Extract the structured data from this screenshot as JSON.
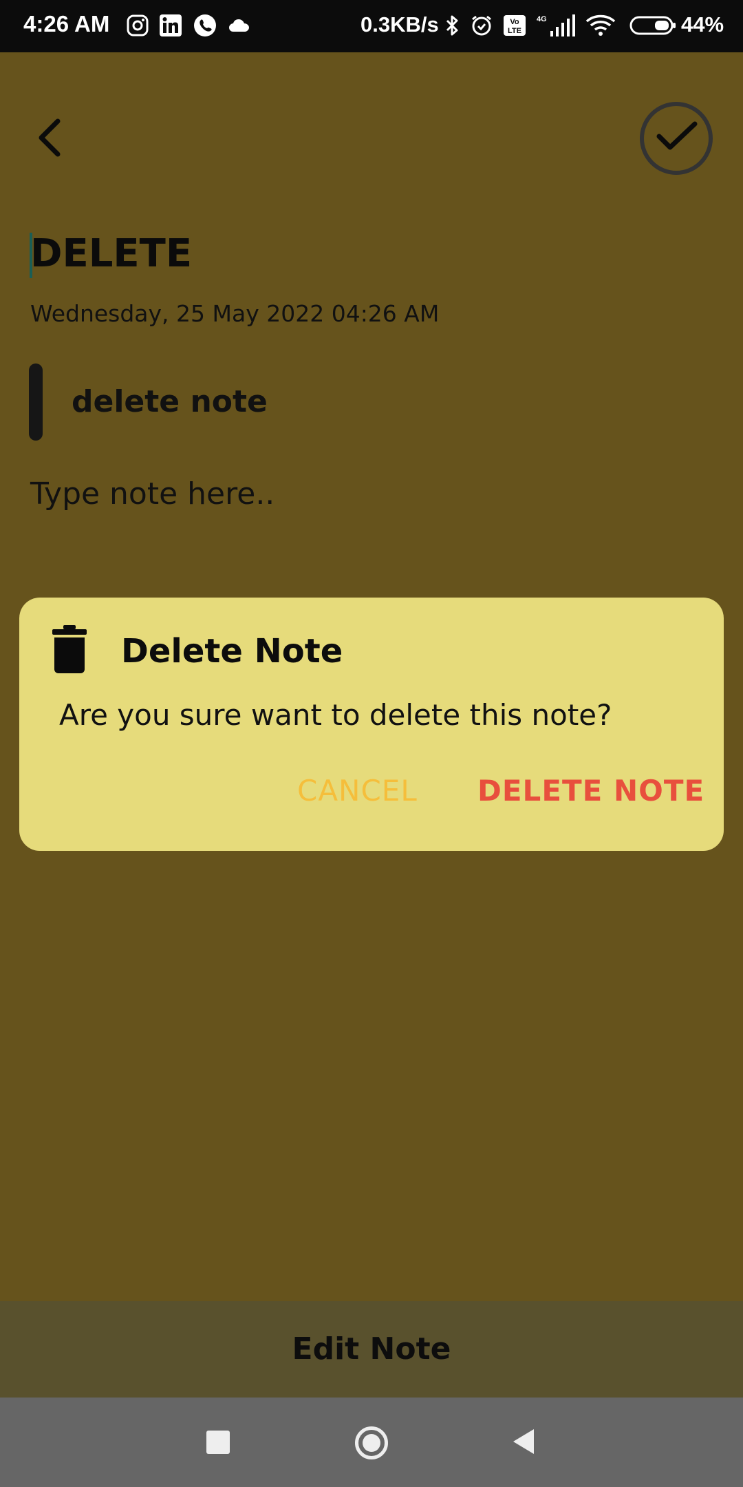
{
  "status_bar": {
    "time": "4:26 AM",
    "speed": "0.3KB/s",
    "battery": "44%",
    "icons": [
      "instagram-icon",
      "linkedin-icon",
      "whatsapp-icon",
      "cloud-icon",
      "bluetooth-icon",
      "alarm-icon",
      "volte-icon",
      "signal-icon",
      "wifi-icon",
      "battery-icon"
    ]
  },
  "note": {
    "title": "DELETE",
    "date": "Wednesday, 25 May 2022 04:26 AM",
    "subtitle": "delete note",
    "body_placeholder": "Type note here.."
  },
  "dialog": {
    "title": "Delete Note",
    "message": "Are you sure want to delete this note?",
    "cancel_label": "CANCEL",
    "delete_label": "DELETE NOTE"
  },
  "bottom": {
    "label": "Edit Note"
  },
  "colors": {
    "background": "#66531c",
    "dialog": "#e6db7b",
    "cancel": "#f5be3b",
    "delete": "#e84f3d"
  }
}
